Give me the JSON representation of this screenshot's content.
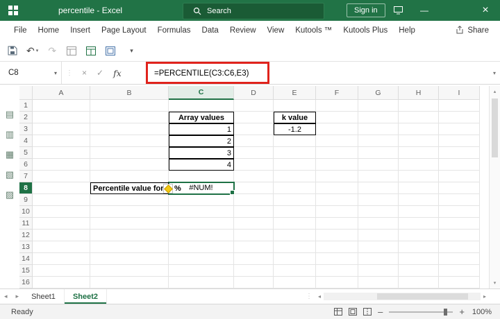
{
  "titlebar": {
    "title": "percentile - Excel",
    "search": "Search",
    "sign_in": "Sign in"
  },
  "menubar": {
    "items": [
      "File",
      "Home",
      "Insert",
      "Page Layout",
      "Formulas",
      "Data",
      "Review",
      "View",
      "Kutools ™",
      "Kutools Plus",
      "Help"
    ],
    "share": "Share"
  },
  "formula_bar": {
    "name_box": "C8",
    "fx": "fx",
    "formula": "=PERCENTILE(C3:C6,E3)"
  },
  "sidebar": {
    "icons": [
      "▤",
      "▥",
      "▦",
      "▧",
      "▨"
    ]
  },
  "grid": {
    "columns": [
      "A",
      "B",
      "C",
      "D",
      "E",
      "F",
      "G",
      "H",
      "I"
    ],
    "row_count": 16,
    "selected_cell": "C8",
    "selected_column": "C",
    "selected_row": 8,
    "cells": [
      {
        "ref": "C2",
        "text": "Array values",
        "bold": true,
        "boxed": true,
        "align": "center"
      },
      {
        "ref": "C3",
        "text": "1",
        "boxed": true,
        "align": "right"
      },
      {
        "ref": "C4",
        "text": "2",
        "boxed": true,
        "align": "right"
      },
      {
        "ref": "C5",
        "text": "3",
        "boxed": true,
        "align": "right"
      },
      {
        "ref": "C6",
        "text": "4",
        "boxed": true,
        "align": "right"
      },
      {
        "ref": "E2",
        "text": "k value",
        "bold": true,
        "boxed": true,
        "align": "center"
      },
      {
        "ref": "E3",
        "text": "-1.2",
        "boxed": true,
        "align": "center"
      },
      {
        "ref": "B8",
        "text": "Percentile value for",
        "suffix": "%",
        "bold": true,
        "boxed": true,
        "align": "left",
        "warning": true
      },
      {
        "ref": "C8",
        "text": "#NUM!",
        "align": "center",
        "selected": true
      }
    ]
  },
  "sheet_tabs": [
    {
      "label": "Sheet1",
      "active": false
    },
    {
      "label": "Sheet2",
      "active": true
    }
  ],
  "status_bar": {
    "mode": "Ready",
    "zoom": "100%"
  },
  "icons": {
    "dropdown": "▾",
    "undo": "↶",
    "redo": "↷",
    "left": "◂",
    "right": "▸",
    "up": "▴",
    "down": "▾",
    "check": "✓",
    "cancel": "×",
    "grip": "⋮",
    "close": "×",
    "minimize": "—",
    "minus": "–",
    "plus": "+"
  },
  "colors": {
    "titlebar_green": "#217346",
    "accent_green": "#1E7145",
    "annotation_red": "#E0231C",
    "warning_yellow": "#F2C811"
  }
}
